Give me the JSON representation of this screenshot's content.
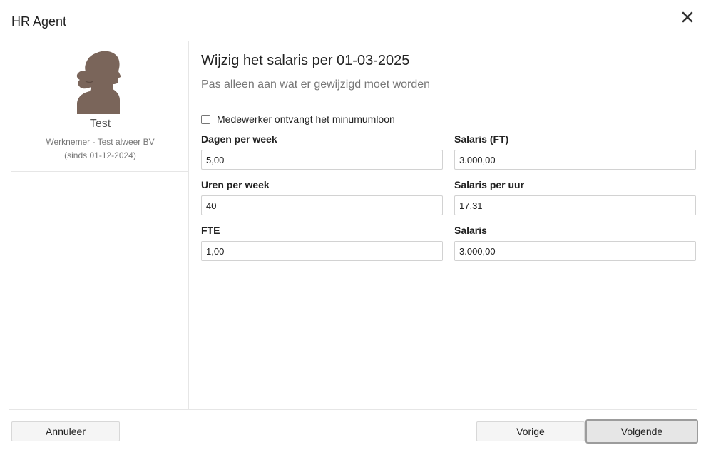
{
  "header": {
    "title": "HR Agent",
    "close_icon": "close-icon"
  },
  "employee": {
    "name": "Test",
    "role_line": "Werknemer - Test alweer BV",
    "since_line": "(sinds 01-12-2024)",
    "avatar_icon": "female-silhouette-avatar"
  },
  "main": {
    "title": "Wijzig het salaris per 01-03-2025",
    "subtitle": "Pas alleen aan wat er gewijzigd moet worden",
    "minimum_wage_checkbox": {
      "label": "Medewerker ontvangt het minumumloon",
      "checked": false
    },
    "fields": {
      "dagen_per_week": {
        "label": "Dagen per week",
        "value": "5,00"
      },
      "salaris_ft": {
        "label": "Salaris (FT)",
        "value": "3.000,00"
      },
      "uren_per_week": {
        "label": "Uren per week",
        "value": "40"
      },
      "salaris_per_uur": {
        "label": "Salaris per uur",
        "value": "17,31"
      },
      "fte": {
        "label": "FTE",
        "value": "1,00"
      },
      "salaris": {
        "label": "Salaris",
        "value": "3.000,00"
      }
    }
  },
  "footer": {
    "cancel_label": "Annuleer",
    "previous_label": "Vorige",
    "next_label": "Volgende"
  },
  "colors": {
    "avatar_fill": "#7a655a",
    "divider": "#e6e6e6",
    "button_bg": "#f5f5f5",
    "primary_button_border": "#9c9c9c"
  }
}
